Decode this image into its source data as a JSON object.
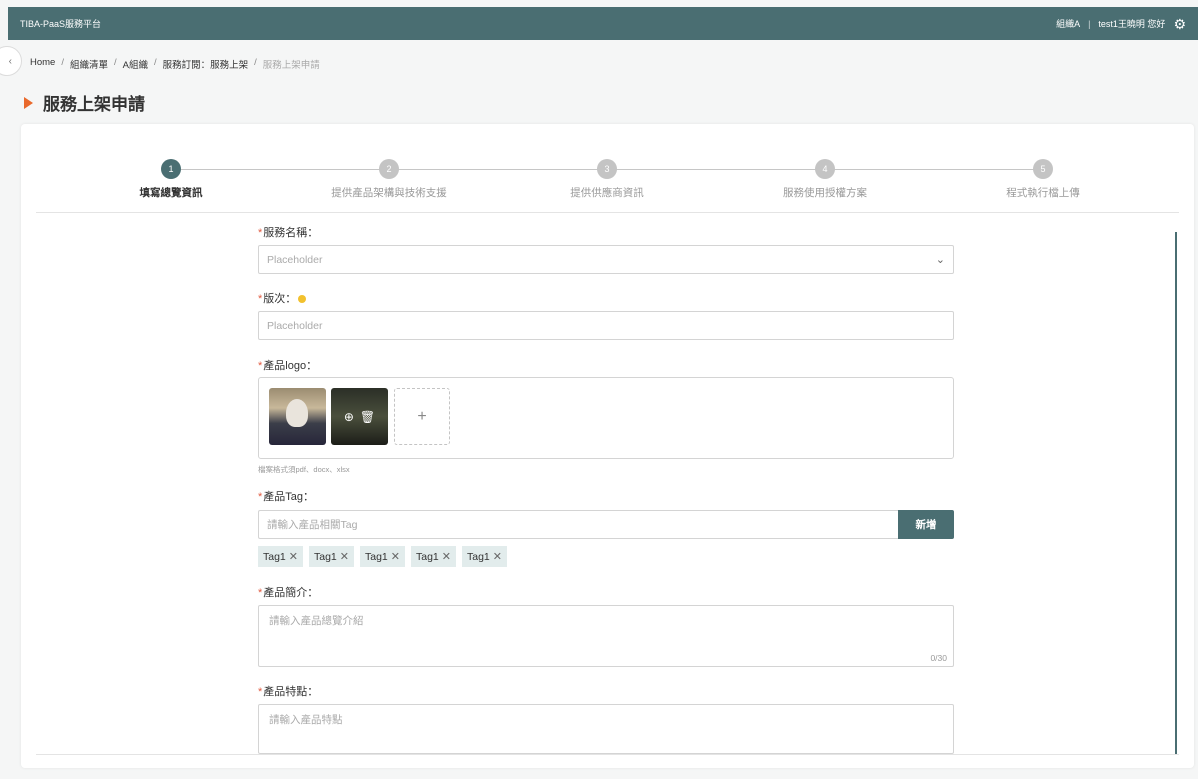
{
  "topbar": {
    "app_title": "TIBA-PaaS服務平台",
    "org": "組織A",
    "separator": "|",
    "greeting": "test1王曉明 您好",
    "settings_icon": "gear-icon"
  },
  "breadcrumb": {
    "items": [
      "Home",
      "組織清單",
      "A組織",
      "服務訂閱：服務上架"
    ],
    "current": "服務上架申請",
    "separator": "/"
  },
  "page": {
    "title": "服務上架申請",
    "accent": "#e9692c"
  },
  "steps": [
    {
      "number": "1",
      "label": "填寫總覽資訊",
      "active": true
    },
    {
      "number": "2",
      "label": "提供產品架構與技術支援",
      "active": false
    },
    {
      "number": "3",
      "label": "提供供應商資訊",
      "active": false
    },
    {
      "number": "4",
      "label": "服務使用授權方案",
      "active": false
    },
    {
      "number": "5",
      "label": "程式執行檔上傳",
      "active": false
    }
  ],
  "form": {
    "required_mark": "*",
    "service_name": {
      "label": "服務名稱：",
      "placeholder": "Placeholder"
    },
    "version": {
      "label": "版次：",
      "placeholder": "Placeholder"
    },
    "logo": {
      "label": "產品logo：",
      "hint": "檔案格式須pdf、docx、xlsx",
      "add_symbol": "+"
    },
    "tag": {
      "label": "產品Tag：",
      "placeholder": "請輸入產品相關Tag",
      "add_button": "新增",
      "tags": [
        "Tag1",
        "Tag1",
        "Tag1",
        "Tag1",
        "Tag1"
      ]
    },
    "intro": {
      "label": "產品簡介：",
      "placeholder": "請輸入產品總覽介紹",
      "counter": "0/30"
    },
    "features": {
      "label": "產品特點：",
      "placeholder": "請輸入產品特點"
    }
  },
  "colors": {
    "primary": "#4a6e72",
    "required": "#e15a40",
    "warning": "#f2c12e",
    "tag_bg": "#e2ecec"
  }
}
